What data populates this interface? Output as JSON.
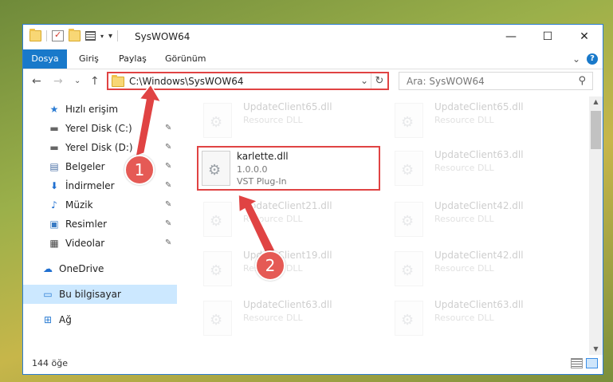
{
  "window": {
    "title": "SysWOW64",
    "controls": {
      "minimize": "—",
      "maximize": "☐",
      "close": "✕"
    }
  },
  "ribbon": {
    "tabs": [
      "Dosya",
      "Giriş",
      "Paylaş",
      "Görünüm"
    ],
    "expand_glyph": "⌄",
    "help_glyph": "?"
  },
  "navigation": {
    "back_glyph": "←",
    "forward_glyph": "→",
    "recent_glyph": "⌄",
    "up_glyph": "↑",
    "address": "C:\\Windows\\SysWOW64",
    "address_dropdown_glyph": "⌄",
    "refresh_glyph": "↻",
    "search_placeholder": "Ara: SysWOW64",
    "search_glyph": "⚲"
  },
  "sidebar": {
    "items": [
      {
        "label": "Hızlı erişim",
        "icon": "star-icon",
        "glyph": "★",
        "pinned": false
      },
      {
        "label": "Yerel Disk (C:)",
        "icon": "drive-icon",
        "glyph": "▬",
        "pinned": true
      },
      {
        "label": "Yerel Disk (D:)",
        "icon": "drive-icon",
        "glyph": "▬",
        "pinned": true
      },
      {
        "label": "Belgeler",
        "icon": "documents-icon",
        "glyph": "▤",
        "pinned": true
      },
      {
        "label": "İndirmeler",
        "icon": "download-icon",
        "glyph": "⬇",
        "pinned": true
      },
      {
        "label": "Müzik",
        "icon": "music-icon",
        "glyph": "♪",
        "pinned": true
      },
      {
        "label": "Resimler",
        "icon": "pictures-icon",
        "glyph": "▣",
        "pinned": true
      },
      {
        "label": "Videolar",
        "icon": "video-icon",
        "glyph": "▦",
        "pinned": true
      },
      {
        "label": "OneDrive",
        "icon": "cloud-icon",
        "glyph": "☁",
        "pinned": false
      },
      {
        "label": "Bu bilgisayar",
        "icon": "computer-icon",
        "glyph": "▭",
        "pinned": false,
        "selected": true
      },
      {
        "label": "Ağ",
        "icon": "network-icon",
        "glyph": "⊞",
        "pinned": false
      }
    ],
    "pin_glyph": "📌"
  },
  "files": {
    "highlighted": {
      "name": "karlette.dll",
      "line2": "1.0.0.0",
      "line3": "VST Plug-In"
    },
    "faded": [
      {
        "name": "UpdateClient65.dll",
        "type": "Resource DLL"
      },
      {
        "name": "UpdateClient65.dll",
        "type": "Resource DLL"
      },
      {
        "name": "UpdateClient63.dll",
        "type": "Resource DLL"
      },
      {
        "name": "UpdateClient21.dll",
        "type": "Resource DLL"
      },
      {
        "name": "UpdateClient42.dll",
        "type": "Resource DLL"
      },
      {
        "name": "UpdateClient19.dll",
        "type": "Resource DLL"
      },
      {
        "name": "UpdateClient42.dll",
        "type": "Resource DLL"
      },
      {
        "name": "UpdateClient63.dll",
        "type": "Resource DLL"
      },
      {
        "name": "UpdateClient63.dll",
        "type": "Resource DLL"
      }
    ]
  },
  "status": {
    "item_count": "144 öğe"
  },
  "annotations": {
    "step1": "1",
    "step2": "2",
    "color": "#e04343"
  }
}
